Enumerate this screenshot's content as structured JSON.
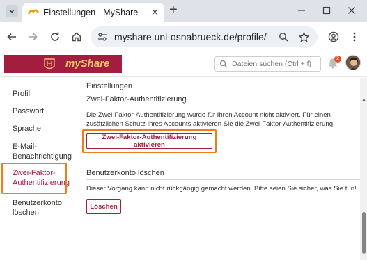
{
  "browser": {
    "tab_title": "Einstellungen - MyShare",
    "url": "myshare.uni-osnabrueck.de/profile/#tw..."
  },
  "app": {
    "logo_text": "myShare",
    "search_placeholder": "Dateien suchen (Ctrl + f)",
    "notification_count": "2"
  },
  "sidebar": {
    "items": [
      {
        "label": "Profil"
      },
      {
        "label": "Passwort"
      },
      {
        "label": "Sprache"
      },
      {
        "label": "E-Mail-Benachrichtigung"
      },
      {
        "label": "Zwei-Faktor-Authentifizierung"
      },
      {
        "label": "Benutzerkonto löschen"
      }
    ]
  },
  "main": {
    "title": "Einstellungen",
    "twofa": {
      "heading": "Zwei-Faktor-Authentifizierung",
      "description": "Die Zwei-Faktor-Authentifizierung wurde für Ihren Account nicht aktiviert. Für einen zusätzlichen Schutz Ihres Accounts aktivieren Sie die Zwei-Faktor-Authentifizierung.",
      "button": "Zwei-Faktor-Authentifizierung aktivieren"
    },
    "delete": {
      "heading": "Benutzerkonto löschen",
      "description": "Dieser Vorgang kann nicht rückgängig gemacht werden. Bitte seien Sie sicher, was Sie tun!",
      "button": "Löschen"
    }
  },
  "colors": {
    "brand": "#a31d3f",
    "highlight": "#f07d1a"
  }
}
